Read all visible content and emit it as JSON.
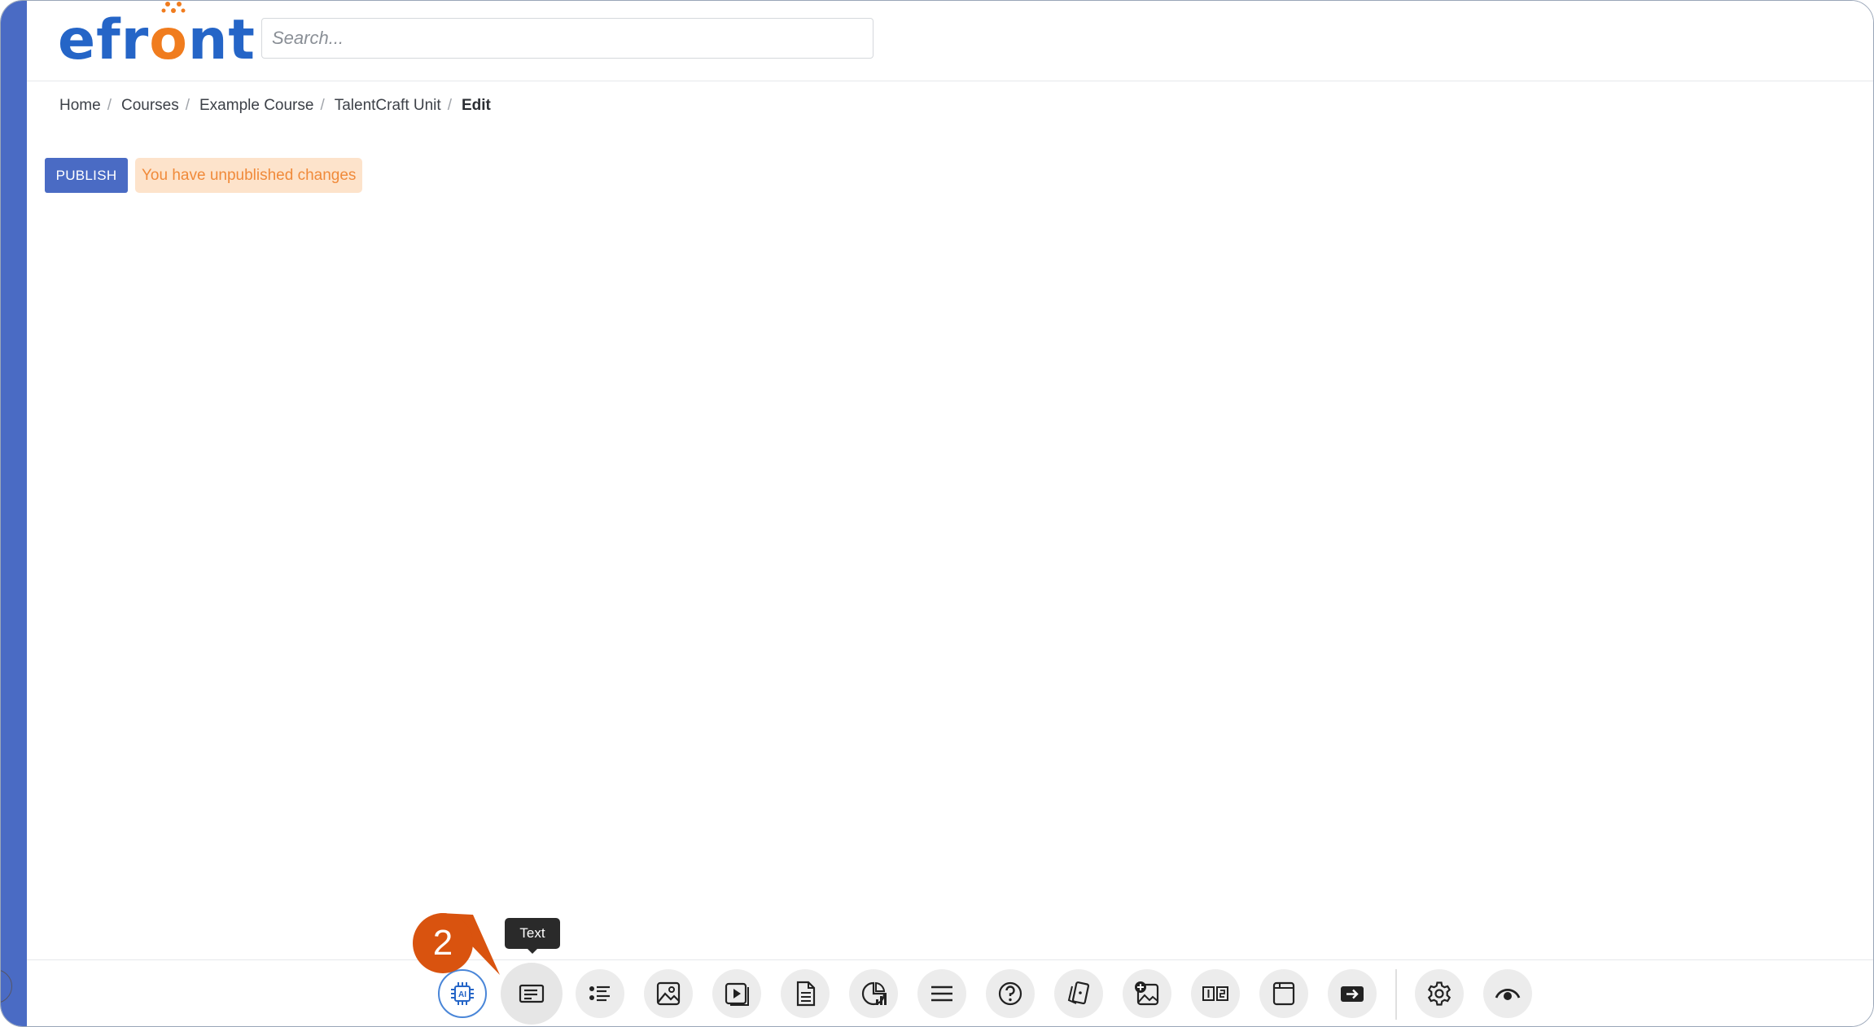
{
  "header": {
    "logo": {
      "part1": "efr",
      "part2": "o",
      "part3": "nt"
    },
    "search": {
      "placeholder": "Search...",
      "value": ""
    }
  },
  "breadcrumb": {
    "items": [
      "Home",
      "Courses",
      "Example Course",
      "TalentCraft Unit"
    ],
    "separator": "/",
    "current": "Edit"
  },
  "actions": {
    "publish_label": "PUBLISH",
    "status_text": "You have unpublished changes"
  },
  "toolbar": {
    "tooltip": "Text",
    "step_number": "2",
    "buttons": [
      {
        "name": "ai-icon",
        "label": "AI"
      },
      {
        "name": "text-icon"
      },
      {
        "name": "list-icon"
      },
      {
        "name": "image-icon"
      },
      {
        "name": "video-icon"
      },
      {
        "name": "document-icon"
      },
      {
        "name": "chart-icon"
      },
      {
        "name": "divider-icon"
      },
      {
        "name": "question-icon"
      },
      {
        "name": "cards-icon"
      },
      {
        "name": "image-add-icon"
      },
      {
        "name": "columns-icon"
      },
      {
        "name": "window-icon"
      },
      {
        "name": "embed-icon"
      },
      {
        "name": "settings-icon"
      },
      {
        "name": "preview-icon"
      }
    ]
  },
  "colors": {
    "brand_blue": "#2565c7",
    "brand_orange": "#f07c1e",
    "accent": "#4a6bc4",
    "warning_bg": "#fde3cb",
    "warning_text": "#f08a3a",
    "step_badge": "#d9530f"
  }
}
